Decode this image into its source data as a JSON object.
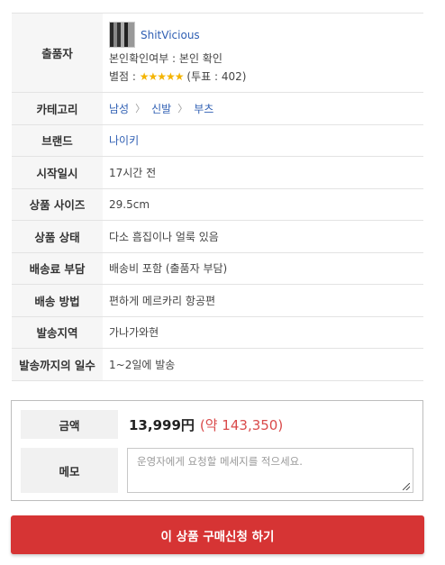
{
  "labels": {
    "seller": "출품자",
    "category": "카테고리",
    "brand": "브랜드",
    "start_time": "시작일시",
    "size": "상품 사이즈",
    "condition": "상품 상태",
    "shipping_fee": "배송료 부담",
    "shipping_method": "배송 방법",
    "ship_from": "발송지역",
    "days_to_ship": "발송까지의 일수"
  },
  "seller": {
    "name": "ShitVicious",
    "verification": "본인확인여부 : 본인 확인",
    "rating_label": "별점 : ",
    "stars": "★★★★★",
    "votes": "(투표 : 402)",
    "avatar_icon": "seller-avatar"
  },
  "category": {
    "items": [
      "남성",
      "신발",
      "부츠"
    ],
    "separator": "〉"
  },
  "values": {
    "brand": "나이키",
    "start_time": "17시간 전",
    "size": "29.5cm",
    "condition": "다소 흠집이나 얼룩 있음",
    "shipping_fee": "배송비 포함 (출품자 부담)",
    "shipping_method": "편하게 메르카리 항공편",
    "ship_from": "가나가와현",
    "days_to_ship": "1~2일에 발송"
  },
  "order": {
    "price_label": "금액",
    "price_yen": "13,999円",
    "price_krw": "(약 143,350)",
    "memo_label": "메모",
    "memo_placeholder": "운영자에게 요청할 메세지를 적으세요.",
    "buy_button": "이 상품 구매신청 하기"
  },
  "colors": {
    "link": "#2f5fb3",
    "star": "#f4b400",
    "price_krw": "#d94a4a",
    "buy_button_bg": "#d63434"
  }
}
